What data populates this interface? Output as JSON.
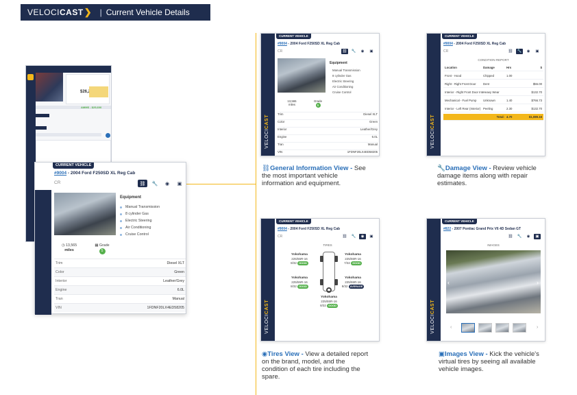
{
  "banner": {
    "logo_light": "VELOCI",
    "logo_bold": "CAST",
    "separator": "|",
    "title": "Current Vehicle Details"
  },
  "phone": {
    "price": "$26,200",
    "amount_line": "AMMS - $25,600"
  },
  "vehicle": {
    "stock": "#9004",
    "name": " - 2004 Ford F250SD XL Reg Cab",
    "current_label": "CURRENT VEHICLE",
    "cr_label": "CR",
    "equipment_title": "Equipment",
    "equipment": [
      "Manual Transmission",
      "8 cylinder Gas",
      "Electric Steering",
      "Air Conditioning",
      "Cruise Control"
    ],
    "miles_value": "13,565",
    "miles_label": "miles",
    "grade_label": "Grade",
    "grade_value": "5",
    "specs": [
      {
        "key": "Trim",
        "value": "Diesel XLT"
      },
      {
        "key": "Color",
        "value": "Green"
      },
      {
        "key": "Interior",
        "value": "Leather/Grey"
      },
      {
        "key": "Engine",
        "value": "6.0L"
      },
      {
        "key": "Tran",
        "value": "Manual"
      },
      {
        "key": "VIN",
        "value": "1FDNF20LX4ED58205"
      }
    ]
  },
  "damage": {
    "report_title": "CONDITION REPORT",
    "headers": [
      "Location",
      "Damage",
      "Hrs",
      "$"
    ],
    "rows": [
      [
        "Front - Hood",
        "Chipped",
        "1.00",
        ""
      ],
      [
        "Right - Right Front Door",
        "Dent",
        "",
        "$55.00"
      ],
      [
        "Interior - Right Front Door Interior",
        "Heavy Wear",
        "",
        "$132.70"
      ],
      [
        "Mechanical - Fuel Pump",
        "Unknown",
        "1.40",
        "$766.73"
      ],
      [
        "Interior - Left Rear (Interior)",
        "Peeling",
        "2.30",
        "$132.70"
      ]
    ],
    "total_label": "Total:",
    "total_hrs": "4.70",
    "total_amount": "$1,089.16"
  },
  "tires": {
    "title": "TIRES",
    "items": [
      {
        "brand": "Yokohama",
        "size": "225/55R-16",
        "tread": "8/32",
        "status": "GOOD"
      },
      {
        "brand": "Yokohama",
        "size": "225/55R-16",
        "tread": "7/32",
        "status": "GOOD"
      },
      {
        "brand": "Yokohama",
        "size": "225/55R-16",
        "tread": "8/32",
        "status": "GOOD"
      },
      {
        "brand": "Yokohama",
        "size": "225/55R-16",
        "tread": "8/32",
        "status": "AVERAGE"
      },
      {
        "brand": "Yokohama",
        "size": "225/55R-16",
        "tread": "8/32",
        "status": "GOOD"
      }
    ]
  },
  "images_view": {
    "stock": "#822",
    "name": " - 2007 Pontiac Grand Prix V6 4D Sedan GT",
    "title": "IMAGES"
  },
  "captions": {
    "general": {
      "label": "General Information View -",
      "text": " See the most important vehicle information and equipment."
    },
    "damage": {
      "label": "Damage View -",
      "text": " Review vehicle damage items along with repair estimates."
    },
    "tires": {
      "label": "Tires View -",
      "text": " View a detailed report on the brand, model, and the condition of each tire including the spare."
    },
    "images": {
      "label": "Images View -",
      "text": " Kick the vehicle's virtual tires by seeing all available vehicle images."
    }
  },
  "colors": {
    "navy": "#1f2d4e",
    "accent": "#f3b71b",
    "link": "#2a6fb8",
    "good": "#55b04c"
  }
}
